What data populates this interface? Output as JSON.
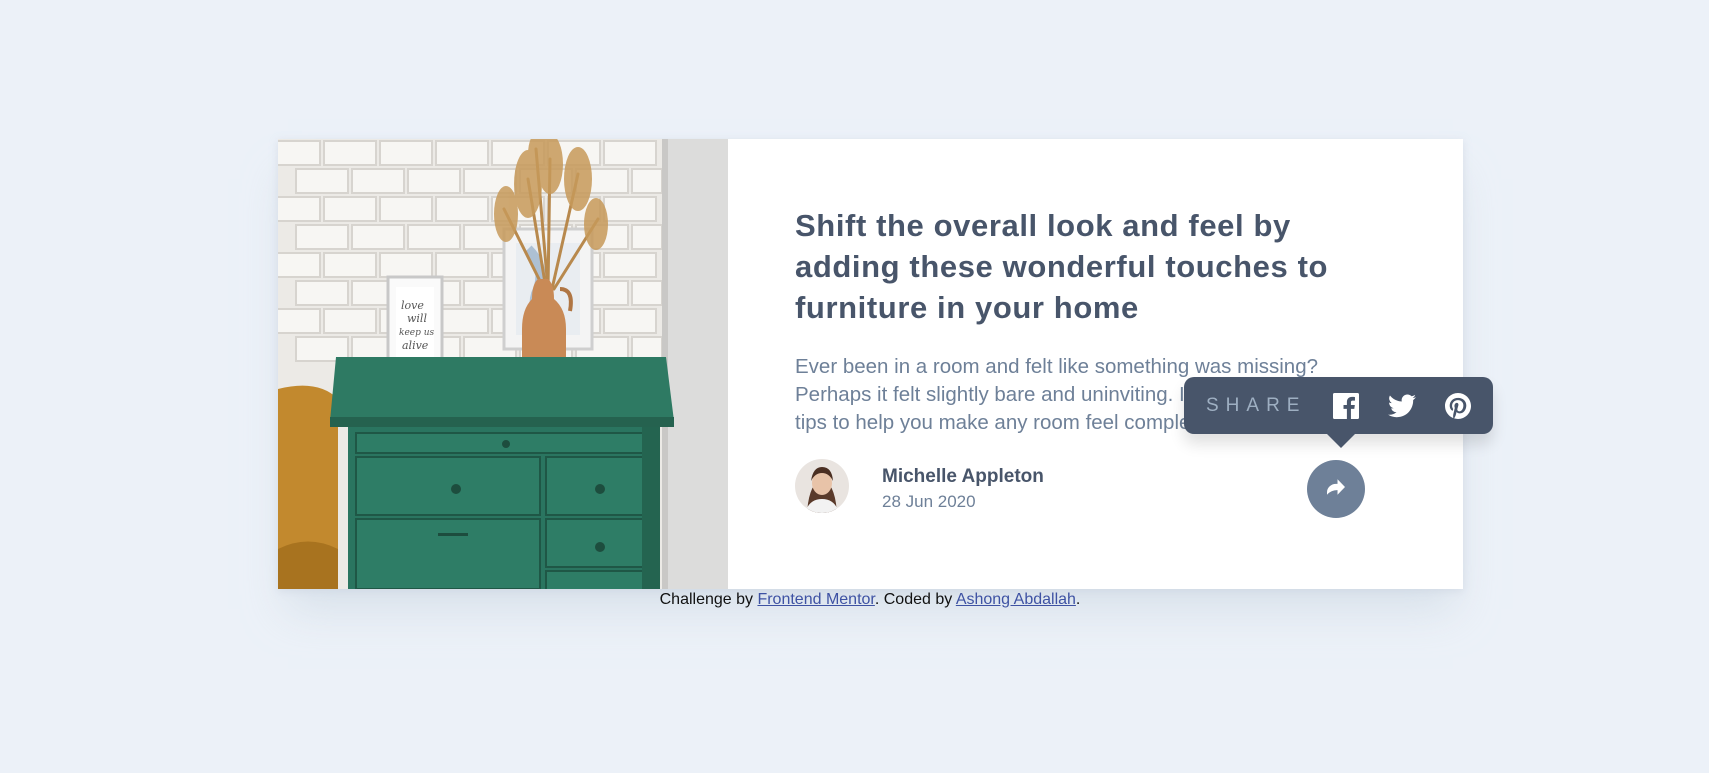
{
  "article": {
    "image_alt": "drawers",
    "headline": "Shift the overall look and feel by adding these wonderful touches to furniture in your home",
    "excerpt": "Ever been in a room and felt like something was missing? Perhaps it felt slightly bare and uninviting. I’ve got some simple tips to help you make any room feel complete."
  },
  "author": {
    "name": "Michelle Appleton",
    "date": "28 Jun 2020",
    "avatar_icon": "avatar"
  },
  "share": {
    "label": "SHARE",
    "toggle_icon": "share-arrow-icon",
    "networks": [
      "facebook-icon",
      "twitter-icon",
      "pinterest-icon"
    ]
  },
  "attribution": {
    "prefix": "Challenge by ",
    "link1": "Frontend Mentor",
    "middle": ". Coded by ",
    "link2": "Ashong Abdallah",
    "suffix": "."
  },
  "colors": {
    "background": "#ecf1f8",
    "dark_blue": "#48556a",
    "grayish_blue": "#6e8098",
    "light_grayish_blue": "#9eafc2"
  }
}
